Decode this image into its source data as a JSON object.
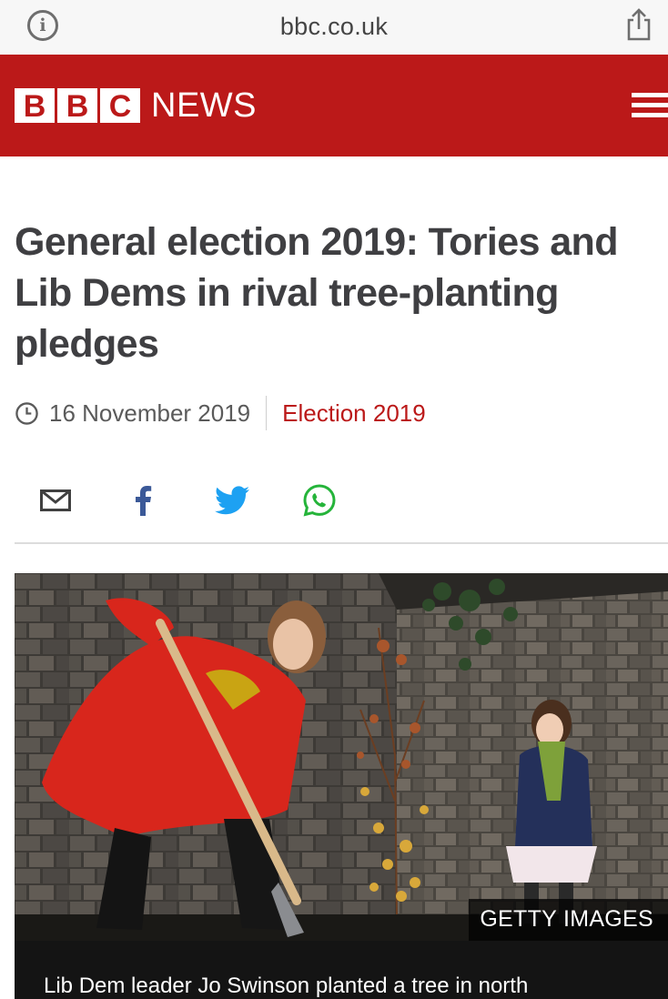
{
  "browser": {
    "url": "bbc.co.uk",
    "icons": {
      "info": "info-circle-icon",
      "share": "share-icon"
    }
  },
  "header": {
    "logo_letters": [
      "B",
      "B",
      "C"
    ],
    "logo_word": "NEWS",
    "brand_color": "#bb1919",
    "menu_icon": "hamburger-menu-icon"
  },
  "article": {
    "headline": "General election 2019: Tories and Lib Dems in rival tree-planting pledges",
    "date": "16 November 2019",
    "section": "Election 2019",
    "share": [
      {
        "icon": "email-icon"
      },
      {
        "icon": "facebook-icon"
      },
      {
        "icon": "twitter-icon"
      },
      {
        "icon": "whatsapp-icon"
      }
    ],
    "image": {
      "credit": "GETTY IMAGES",
      "caption": "Lib Dem leader Jo Swinson planted a tree in north"
    }
  }
}
